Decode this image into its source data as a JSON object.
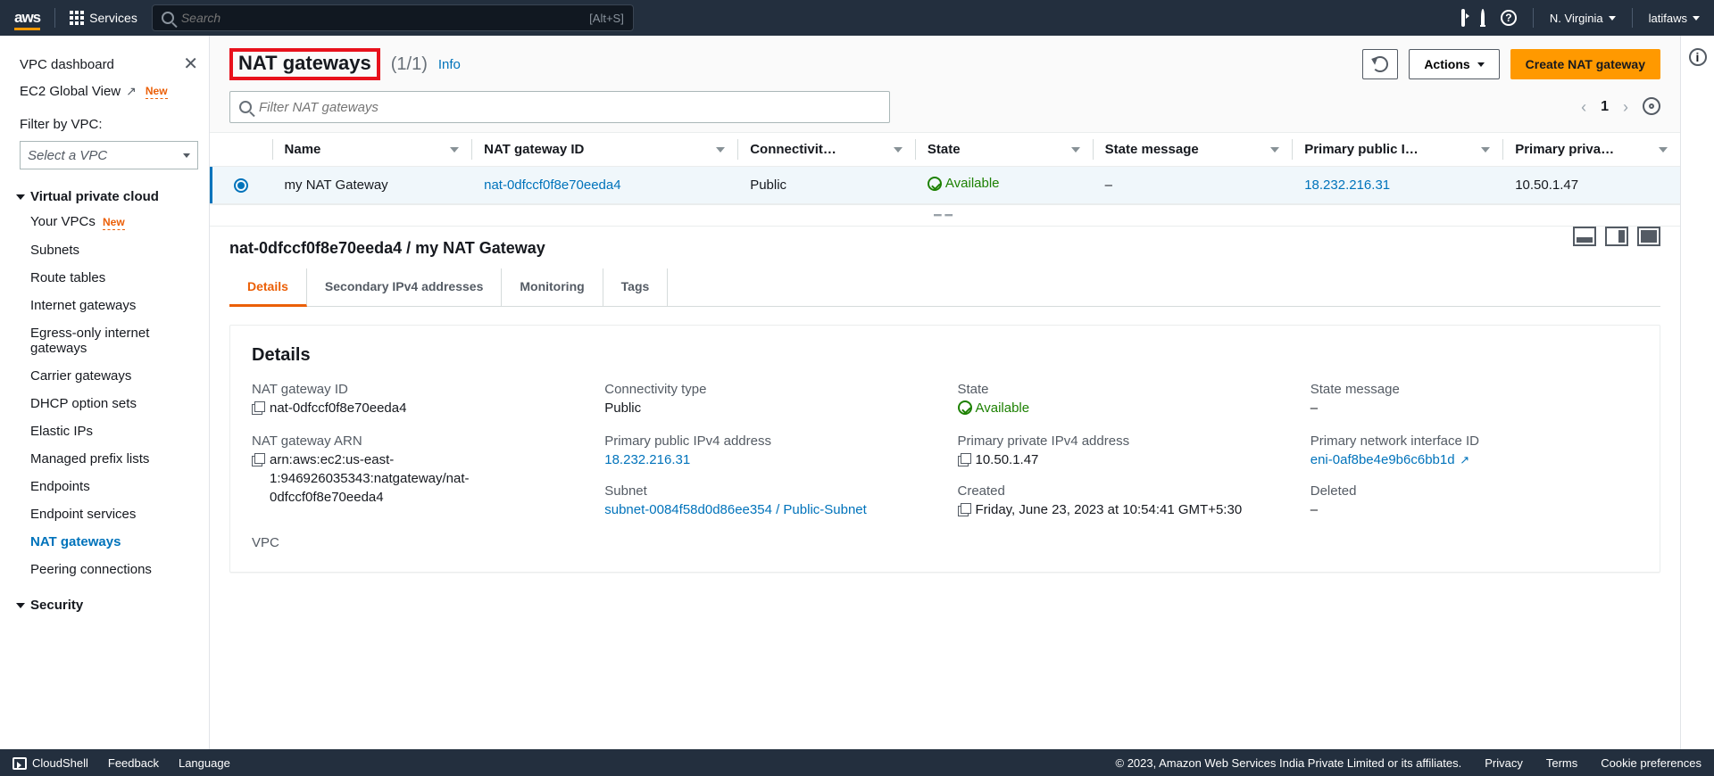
{
  "topbar": {
    "logo": "aws",
    "services": "Services",
    "search_placeholder": "Search",
    "shortcut": "[Alt+S]",
    "region": "N. Virginia",
    "user": "latifaws"
  },
  "leftnav": {
    "dashboard": "VPC dashboard",
    "ec2_global": "EC2 Global View",
    "new_badge": "New",
    "filter_label": "Filter by VPC:",
    "select_placeholder": "Select a VPC",
    "section_vpc": "Virtual private cloud",
    "items_vpc": [
      {
        "label": "Your VPCs",
        "new": true
      },
      {
        "label": "Subnets"
      },
      {
        "label": "Route tables"
      },
      {
        "label": "Internet gateways"
      },
      {
        "label": "Egress-only internet gateways"
      },
      {
        "label": "Carrier gateways"
      },
      {
        "label": "DHCP option sets"
      },
      {
        "label": "Elastic IPs"
      },
      {
        "label": "Managed prefix lists"
      },
      {
        "label": "Endpoints"
      },
      {
        "label": "Endpoint services"
      },
      {
        "label": "NAT gateways",
        "active": true
      },
      {
        "label": "Peering connections"
      }
    ],
    "section_security": "Security"
  },
  "header": {
    "title": "NAT gateways",
    "count": "(1/1)",
    "info": "Info",
    "actions": "Actions",
    "create": "Create NAT gateway",
    "filter_placeholder": "Filter NAT gateways",
    "page": "1"
  },
  "table": {
    "cols": [
      "Name",
      "NAT gateway ID",
      "Connectivit…",
      "State",
      "State message",
      "Primary public I…",
      "Primary priva…"
    ],
    "row": {
      "name": "my NAT Gateway",
      "id": "nat-0dfccf0f8e70eeda4",
      "conn": "Public",
      "state": "Available",
      "msg": "–",
      "pubip": "18.232.216.31",
      "privip": "10.50.1.47"
    }
  },
  "detail": {
    "heading": "nat-0dfccf0f8e70eeda4 / my NAT Gateway",
    "tabs": [
      "Details",
      "Secondary IPv4 addresses",
      "Monitoring",
      "Tags"
    ],
    "card_title": "Details",
    "natid_label": "NAT gateway ID",
    "natid": "nat-0dfccf0f8e70eeda4",
    "conn_label": "Connectivity type",
    "conn": "Public",
    "state_label": "State",
    "state": "Available",
    "msg_label": "State message",
    "msg": "–",
    "arn_label": "NAT gateway ARN",
    "arn": "arn:aws:ec2:us-east-1:946926035343:natgateway/nat-0dfccf0f8e70eeda4",
    "pubip_label": "Primary public IPv4 address",
    "pubip": "18.232.216.31",
    "privip_label": "Primary private IPv4 address",
    "privip": "10.50.1.47",
    "eni_label": "Primary network interface ID",
    "eni": "eni-0af8be4e9b6c6bb1d",
    "subnet_label": "Subnet",
    "subnet": "subnet-0084f58d0d86ee354 / Public-Subnet",
    "created_label": "Created",
    "created": "Friday, June 23, 2023 at 10:54:41 GMT+5:30",
    "deleted_label": "Deleted",
    "deleted": "–",
    "vpc_label": "VPC"
  },
  "footer": {
    "cloudshell": "CloudShell",
    "feedback": "Feedback",
    "language": "Language",
    "copyright": "© 2023, Amazon Web Services India Private Limited or its affiliates.",
    "privacy": "Privacy",
    "terms": "Terms",
    "cookies": "Cookie preferences"
  }
}
